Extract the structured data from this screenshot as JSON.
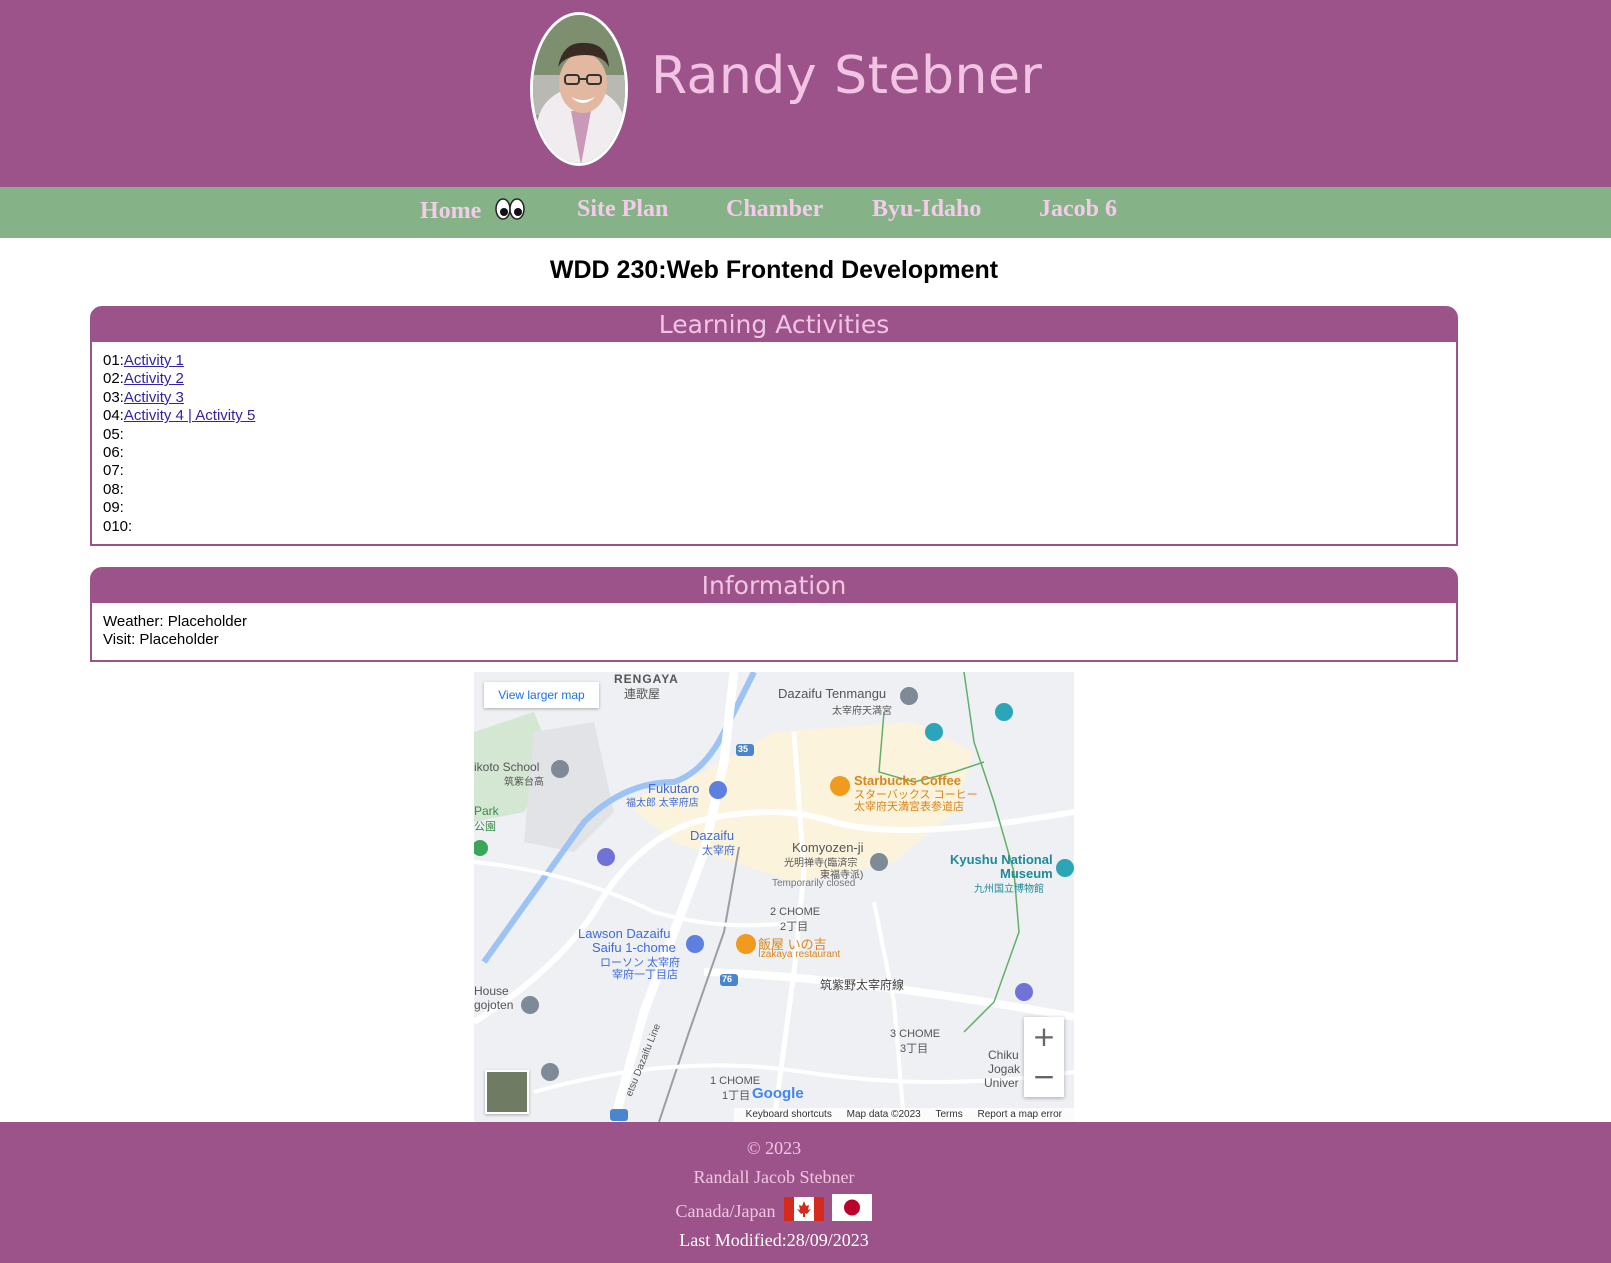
{
  "header": {
    "title": "Randy Stebner"
  },
  "nav": {
    "items": [
      {
        "label": "Home"
      },
      {
        "label": "Site Plan"
      },
      {
        "label": "Chamber"
      },
      {
        "label": "Byu-Idaho"
      },
      {
        "label": "Jacob 6"
      }
    ]
  },
  "main": {
    "heading": "WDD 230:Web Frontend Development",
    "learning": {
      "title": "Learning Activities",
      "rows": [
        {
          "num": "01:",
          "link": "Activity 1"
        },
        {
          "num": "02:",
          "link": "Activity 2"
        },
        {
          "num": "03:",
          "link": "Activity 3"
        },
        {
          "num": "04:",
          "link": "Activity 4 | Activity 5"
        },
        {
          "num": "05:",
          "link": ""
        },
        {
          "num": "06:",
          "link": ""
        },
        {
          "num": "07:",
          "link": ""
        },
        {
          "num": "08:",
          "link": ""
        },
        {
          "num": "09:",
          "link": ""
        },
        {
          "num": "010:",
          "link": ""
        }
      ]
    },
    "information": {
      "title": "Information",
      "weather": "Weather: Placeholder",
      "visit": "Visit: Placeholder"
    }
  },
  "map": {
    "view_larger": "View larger map",
    "zoom_in": "+",
    "zoom_out": "−",
    "attribution": {
      "shortcuts": "Keyboard shortcuts",
      "data": "Map data ©2023",
      "terms": "Terms",
      "report": "Report a map error"
    },
    "google": "Google",
    "places": {
      "rengaya": "RENGAYA",
      "rengaya_jp": "連歌屋",
      "tenmangu": "Dazaifu Tenmangu",
      "tenmangu_jp": "太宰府天満宮",
      "school": "ikoto School",
      "school_jp": "筑紫台高",
      "fukutaro": "Fukutaro",
      "fukutaro_jp": "福太郎 太宰府店",
      "starbucks": "Starbucks Coffee",
      "starbucks_jp": "スターバックス コーヒー",
      "starbucks_jp2": "太宰府天満宮表参道店",
      "park": "Park",
      "park_jp": "公園",
      "dazaifu": "Dazaifu",
      "dazaifu_jp": "太宰府",
      "komyozenji": "Komyozen-ji",
      "komyozenji_jp": "光明禅寺(臨済宗",
      "komyozenji_jp2": "東福寺派)",
      "closed": "Temporarily closed",
      "kyushu": "Kyushu National",
      "museum": "Museum",
      "kyushu_jp": "九州国立博物館",
      "chome2": "2 CHOME",
      "chome2_jp": "2丁目",
      "lawson": "Lawson Dazaifu",
      "lawson2": "Saifu 1-chome",
      "lawson_jp": "ローソン 太宰府",
      "lawson_jp2": "宰府一丁目店",
      "inokichi": "飯屋 いの吉",
      "izakaya": "Izakaya restaurant",
      "house": "House",
      "gojoten": "gojoten",
      "line_jp": "筑紫野太宰府線",
      "chome3": "3 CHOME",
      "chome3_jp": "3丁目",
      "chome1": "1 CHOME",
      "chome1_jp": "1丁目",
      "chiku": "Chiku",
      "jogak": "Jogak",
      "univer": "Univer",
      "railway": "etsu Dazaifu Line",
      "route35": "35",
      "route76": "76"
    }
  },
  "footer": {
    "copyright": "© 2023",
    "name": "Randall Jacob Stebner",
    "location": "Canada/Japan",
    "modified": "Last Modified:28/09/2023"
  },
  "colors": {
    "header_bg": "#9b538a",
    "nav_bg": "#85b287",
    "accent_text": "#f2c4e4",
    "link": "#3223a8"
  }
}
